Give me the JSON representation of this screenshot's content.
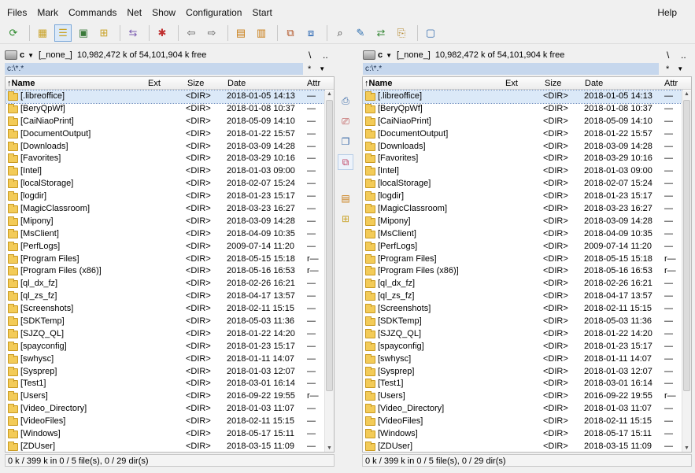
{
  "menu": {
    "items": [
      "Files",
      "Mark",
      "Commands",
      "Net",
      "Show",
      "Configuration",
      "Start"
    ],
    "help": "Help"
  },
  "toolbar": {
    "icons": [
      "refresh-icon",
      "brief-view-icon",
      "full-view-icon",
      "thumbnail-view-icon",
      "tree-view-icon",
      "invert-selection-icon",
      "unpack-icon",
      "back-arrow-icon",
      "forward-arrow-icon",
      "pack-icon",
      "unpack-files-icon",
      "ftp-connect-icon",
      "ftp-new-connection-icon",
      "find-files-icon",
      "multi-rename-icon",
      "sync-dirs-icon",
      "copy-names-icon",
      "notepad-icon"
    ]
  },
  "left": {
    "drive": "c",
    "volume": "[_none_]",
    "space": "10,982,472 k of 54,101,904 k free",
    "root_btn": "\\",
    "up_btn": "..",
    "path": "c:\\*.*",
    "star": "*",
    "caret": "▼",
    "status": "0 k / 399 k in 0 / 5 file(s), 0 / 29 dir(s)"
  },
  "right": {
    "drive": "c",
    "volume": "[_none_]",
    "space": "10,982,472 k of 54,101,904 k free",
    "root_btn": "\\",
    "up_btn": "..",
    "path": "c:\\*.*",
    "star": "*",
    "caret": "▼",
    "status": "0 k / 399 k in 0 / 5 file(s), 0 / 29 dir(s)"
  },
  "columns": {
    "name": "↑Name",
    "ext": "Ext",
    "size": "Size",
    "date": "Date",
    "attr": "Attr"
  },
  "rows": [
    {
      "name": "[.libreoffice]",
      "size": "<DIR>",
      "date": "2018-01-05 14:13",
      "attr": "—"
    },
    {
      "name": "[BeryQpWf]",
      "size": "<DIR>",
      "date": "2018-01-08 10:37",
      "attr": "—"
    },
    {
      "name": "[CaiNiaoPrint]",
      "size": "<DIR>",
      "date": "2018-05-09 14:10",
      "attr": "—"
    },
    {
      "name": "[DocumentOutput]",
      "size": "<DIR>",
      "date": "2018-01-22 15:57",
      "attr": "—"
    },
    {
      "name": "[Downloads]",
      "size": "<DIR>",
      "date": "2018-03-09 14:28",
      "attr": "—"
    },
    {
      "name": "[Favorites]",
      "size": "<DIR>",
      "date": "2018-03-29 10:16",
      "attr": "—"
    },
    {
      "name": "[Intel]",
      "size": "<DIR>",
      "date": "2018-01-03 09:00",
      "attr": "—"
    },
    {
      "name": "[localStorage]",
      "size": "<DIR>",
      "date": "2018-02-07 15:24",
      "attr": "—"
    },
    {
      "name": "[logdir]",
      "size": "<DIR>",
      "date": "2018-01-23 15:17",
      "attr": "—"
    },
    {
      "name": "[MagicClassroom]",
      "size": "<DIR>",
      "date": "2018-03-23 16:27",
      "attr": "—"
    },
    {
      "name": "[Mipony]",
      "size": "<DIR>",
      "date": "2018-03-09 14:28",
      "attr": "—"
    },
    {
      "name": "[MsClient]",
      "size": "<DIR>",
      "date": "2018-04-09 10:35",
      "attr": "—"
    },
    {
      "name": "[PerfLogs]",
      "size": "<DIR>",
      "date": "2009-07-14 11:20",
      "attr": "—"
    },
    {
      "name": "[Program Files]",
      "size": "<DIR>",
      "date": "2018-05-15 15:18",
      "attr": "r—"
    },
    {
      "name": "[Program Files (x86)]",
      "size": "<DIR>",
      "date": "2018-05-16 16:53",
      "attr": "r—"
    },
    {
      "name": "[ql_dx_fz]",
      "size": "<DIR>",
      "date": "2018-02-26 16:21",
      "attr": "—"
    },
    {
      "name": "[ql_zs_fz]",
      "size": "<DIR>",
      "date": "2018-04-17 13:57",
      "attr": "—"
    },
    {
      "name": "[Screenshots]",
      "size": "<DIR>",
      "date": "2018-02-11 15:15",
      "attr": "—"
    },
    {
      "name": "[SDKTemp]",
      "size": "<DIR>",
      "date": "2018-05-03 11:36",
      "attr": "—"
    },
    {
      "name": "[SJZQ_QL]",
      "size": "<DIR>",
      "date": "2018-01-22 14:20",
      "attr": "—"
    },
    {
      "name": "[spayconfig]",
      "size": "<DIR>",
      "date": "2018-01-23 15:17",
      "attr": "—"
    },
    {
      "name": "[swhysc]",
      "size": "<DIR>",
      "date": "2018-01-11 14:07",
      "attr": "—"
    },
    {
      "name": "[Sysprep]",
      "size": "<DIR>",
      "date": "2018-01-03 12:07",
      "attr": "—"
    },
    {
      "name": "[Test1]",
      "size": "<DIR>",
      "date": "2018-03-01 16:14",
      "attr": "—"
    },
    {
      "name": "[Users]",
      "size": "<DIR>",
      "date": "2016-09-22 19:55",
      "attr": "r—"
    },
    {
      "name": "[Video_Directory]",
      "size": "<DIR>",
      "date": "2018-01-03 11:07",
      "attr": "—"
    },
    {
      "name": "[VideoFiles]",
      "size": "<DIR>",
      "date": "2018-02-11 15:15",
      "attr": "—"
    },
    {
      "name": "[Windows]",
      "size": "<DIR>",
      "date": "2018-05-17 15:11",
      "attr": "—"
    },
    {
      "name": "[ZDUser]",
      "size": "<DIR>",
      "date": "2018-03-15 11:09",
      "attr": "—"
    }
  ],
  "colors": {
    "path_bg": "#c6d7ed",
    "selection": "#dbe9f8",
    "folder": "#f3cb58"
  }
}
